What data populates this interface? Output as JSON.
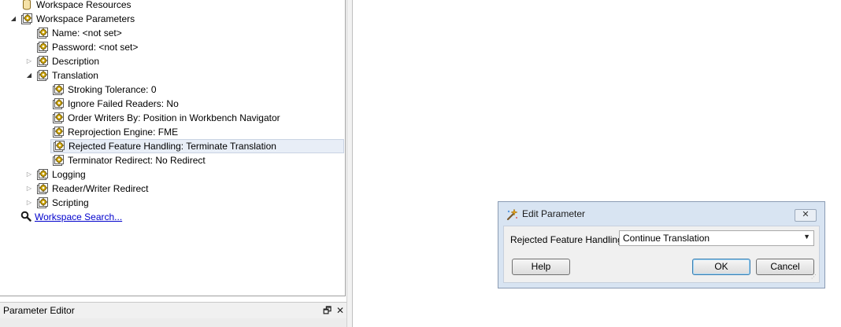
{
  "navigator": {
    "items": [
      {
        "label": "Workspace Resources",
        "icon": "database-icon",
        "twisty": "none",
        "indent": 0
      },
      {
        "label": "Workspace Parameters",
        "icon": "gear-icon",
        "twisty": "open",
        "indent": 0
      },
      {
        "label": "Name: <not set>",
        "icon": "gear-icon",
        "twisty": "none",
        "indent": 1
      },
      {
        "label": "Password: <not set>",
        "icon": "gear-icon",
        "twisty": "none",
        "indent": 1
      },
      {
        "label": "Description",
        "icon": "gear-icon",
        "twisty": "closed",
        "indent": 1
      },
      {
        "label": "Translation",
        "icon": "gear-icon",
        "twisty": "open",
        "indent": 1
      },
      {
        "label": "Stroking Tolerance: 0",
        "icon": "gear-icon",
        "twisty": "none",
        "indent": 2
      },
      {
        "label": "Ignore Failed Readers: No",
        "icon": "gear-icon",
        "twisty": "none",
        "indent": 2
      },
      {
        "label": "Order Writers By: Position in Workbench Navigator",
        "icon": "gear-icon",
        "twisty": "none",
        "indent": 2
      },
      {
        "label": "Reprojection Engine: FME",
        "icon": "gear-icon",
        "twisty": "none",
        "indent": 2
      },
      {
        "label": "Rejected Feature Handling: Terminate Translation",
        "icon": "gear-icon",
        "twisty": "none",
        "indent": 2,
        "selected": true
      },
      {
        "label": "Terminator Redirect: No Redirect",
        "icon": "gear-icon",
        "twisty": "none",
        "indent": 2
      },
      {
        "label": "Logging",
        "icon": "gear-icon",
        "twisty": "closed",
        "indent": 1
      },
      {
        "label": "Reader/Writer Redirect",
        "icon": "gear-icon",
        "twisty": "closed",
        "indent": 1
      },
      {
        "label": "Scripting",
        "icon": "gear-icon",
        "twisty": "closed",
        "indent": 1
      }
    ],
    "search_link": "Workspace Search..."
  },
  "parameter_editor": {
    "title": "Parameter Editor",
    "float_glyph": "🗗",
    "close_glyph": "✕"
  },
  "dialog": {
    "title": "Edit Parameter",
    "close_glyph": "✕",
    "param_label": "Rejected Feature Handling:",
    "param_value": "Continue Translation",
    "help_label": "Help",
    "ok_label": "OK",
    "cancel_label": "Cancel"
  },
  "colors": {
    "gear": "#c9a000",
    "icon_frame": "#5a5a5a",
    "link": "#0000cc",
    "selection": "#e8eef7",
    "dialog_frame": "#d8e4f2"
  }
}
